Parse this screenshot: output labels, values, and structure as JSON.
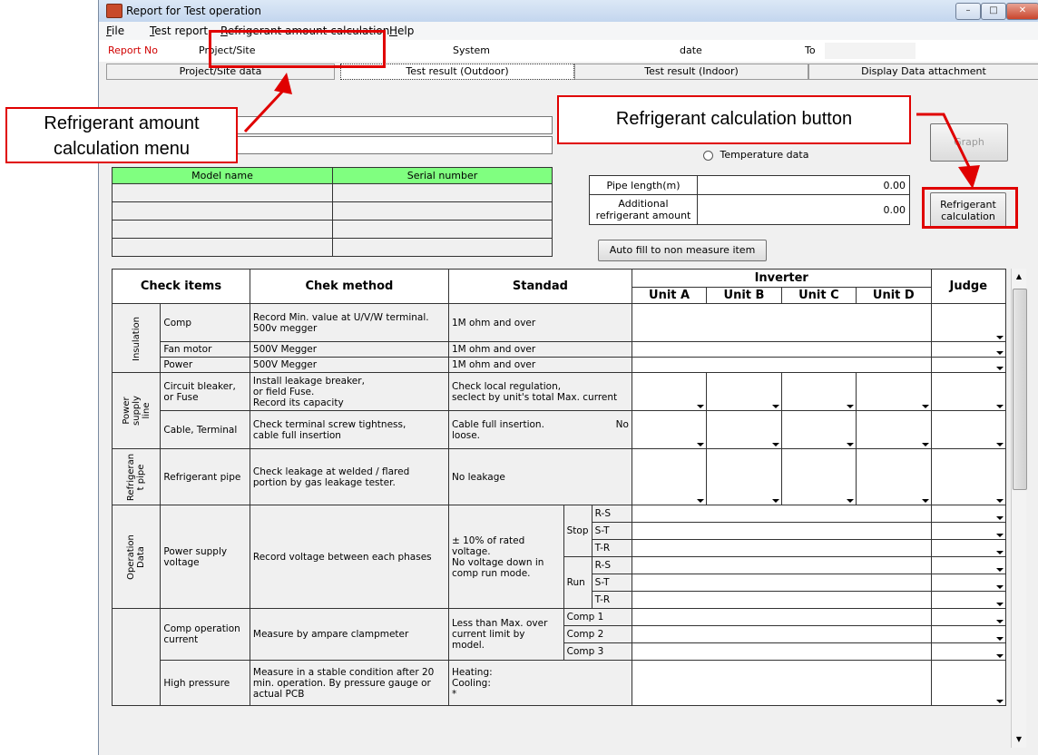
{
  "window": {
    "title": "Report for Test operation",
    "minimize": "–",
    "maximize": "□",
    "close": "✕"
  },
  "menu": {
    "file": "File",
    "test_report": "Test report",
    "refrigerant": "Refrigerant amount calculation",
    "help": "Help"
  },
  "info": {
    "report_no": "Report No",
    "project_site": "Project/Site",
    "system": "System",
    "date": "date",
    "to": "To"
  },
  "tabs": [
    "Project/Site data",
    "Test result (Outdoor)",
    "Test result (Indoor)",
    "Display Data attachment"
  ],
  "radio": {
    "temperature": "Temperature data"
  },
  "buttons": {
    "graph": "Graph",
    "refrigerant_calc": "Refrigerant\ncalculation",
    "autofill": "Auto fill to non measure item"
  },
  "model_table": {
    "headers": [
      "Model name",
      "Serial number"
    ],
    "rows": 4
  },
  "pipe": {
    "length_label": "Pipe length(m)",
    "length_value": "0.00",
    "additional_label": "Additional\nrefrigerant amount",
    "additional_value": "0.00"
  },
  "table": {
    "headers": {
      "check_items": "Check items",
      "method": "Chek method",
      "standard": "Standad",
      "inverter": "Inverter",
      "units": [
        "Unit A",
        "Unit B",
        "Unit C",
        "Unit D"
      ],
      "judge": "Judge"
    },
    "categories": {
      "insulation": "Insulation",
      "power_supply": "Power\nsupply\nline",
      "refrigerant": "Refrigeran\nt pipe",
      "operation": "Operation\nData"
    },
    "rows": {
      "comp": {
        "item": "Comp",
        "method": "Record Min. value at U/V/W terminal.\n500v megger",
        "standard": "1M ohm and over"
      },
      "fan": {
        "item": "Fan motor",
        "method": "500V Megger",
        "standard": "1M ohm and over"
      },
      "power": {
        "item": "Power",
        "method": "500V Megger",
        "standard": "1M ohm and over"
      },
      "circuit": {
        "item": "Circuit bleaker,\nor Fuse",
        "method": "Install leakage breaker,\n or field Fuse.\nRecord its capacity",
        "standard": "Check local regulation,\nseclect by unit's total Max. current"
      },
      "cable": {
        "item": "Cable, Terminal",
        "method": "Check terminal screw tightness,\n cable full insertion",
        "standard": "Cable full insertion.",
        "standard_extra": "No",
        "standard2": "loose."
      },
      "refpipe": {
        "item": "Refrigerant pipe",
        "method": "Check leakage at welded / flared\nportion by gas leakage tester.",
        "standard": "No leakage"
      },
      "voltage": {
        "item": "Power supply\nvoltage",
        "method": "Record voltage between each phases",
        "standard": "± 10% of rated voltage.\n No voltage down in\ncomp run mode.",
        "stop": "Stop",
        "run": "Run",
        "phases": [
          "R-S",
          "S-T",
          "T-R"
        ]
      },
      "current": {
        "item": "Comp operation\ncurrent",
        "method": "Measure by ampare clampmeter",
        "standard": "Less than Max. over\ncurrent limit by model.",
        "comps": [
          "Comp 1",
          "Comp 2",
          "Comp 3"
        ]
      },
      "highp": {
        "item": "High pressure",
        "method": "Measure in a stable condition after 20\nmin. operation. By pressure gauge or\nactual PCB",
        "standard": "Heating:\nCooling:\n*"
      }
    }
  },
  "annotations": {
    "menu_callout": "Refrigerant amount\ncalculation menu",
    "button_callout": "Refrigerant calculation button"
  }
}
